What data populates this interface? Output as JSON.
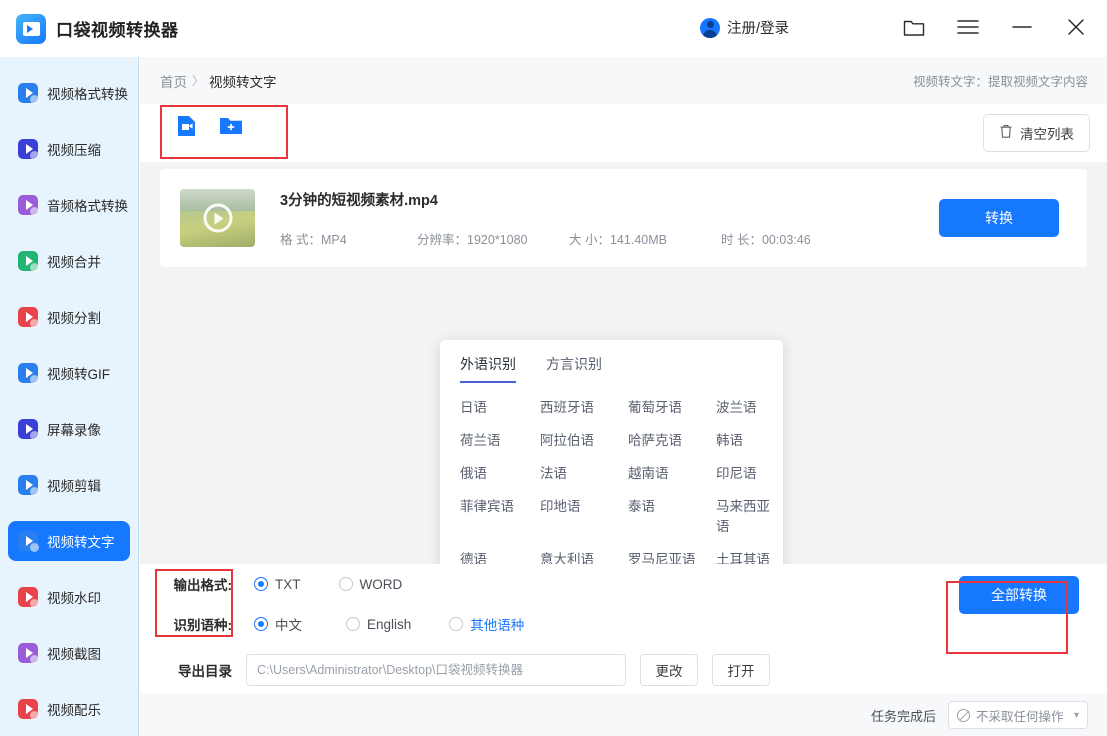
{
  "titlebar": {
    "app_title": "口袋视频转换器",
    "app_icon": "video-converter-logo",
    "account_label": "注册/登录",
    "account_icon": "avatar-icon",
    "window_buttons": [
      {
        "name": "folder-icon",
        "label": "folder"
      },
      {
        "name": "menu-icon",
        "label": "menu"
      },
      {
        "name": "minimize-icon",
        "label": "minimize"
      },
      {
        "name": "close-icon",
        "label": "close"
      }
    ]
  },
  "sidebar": {
    "items": [
      {
        "label": "视频格式转换",
        "icon": "video-format-convert-icon",
        "color": "#2b7ef0",
        "active": false
      },
      {
        "label": "视频压缩",
        "icon": "video-compress-icon",
        "color": "#3a3fd8",
        "active": false
      },
      {
        "label": "音频格式转换",
        "icon": "audio-format-convert-icon",
        "color": "#9a5cd8",
        "active": false
      },
      {
        "label": "视频合并",
        "icon": "video-merge-icon",
        "color": "#22b573",
        "active": false
      },
      {
        "label": "视频分割",
        "icon": "video-split-icon",
        "color": "#e8434a",
        "active": false
      },
      {
        "label": "视频转GIF",
        "icon": "video-to-gif-icon",
        "color": "#2b7ef0",
        "active": false
      },
      {
        "label": "屏幕录像",
        "icon": "screen-record-icon",
        "color": "#3a3fd8",
        "active": false
      },
      {
        "label": "视频剪辑",
        "icon": "video-edit-icon",
        "color": "#2b7ef0",
        "active": false
      },
      {
        "label": "视频转文字",
        "icon": "video-to-text-icon",
        "color": "#2b7ef0",
        "active": true
      },
      {
        "label": "视频水印",
        "icon": "video-watermark-icon",
        "color": "#e8434a",
        "active": false
      },
      {
        "label": "视频截图",
        "icon": "video-screenshot-icon",
        "color": "#9a5cd8",
        "active": false
      },
      {
        "label": "视频配乐",
        "icon": "video-music-icon",
        "color": "#e8434a",
        "active": false
      }
    ]
  },
  "breadcrumb": {
    "home": "首页",
    "separator": "〉",
    "current": "视频转文字",
    "hint": "视频转文字：提取视频文字内容"
  },
  "toolbar": {
    "add_file_icon": "add-video-file-icon",
    "add_folder_icon": "add-folder-icon",
    "clear_label": "清空列表",
    "clear_icon": "trash-icon"
  },
  "file": {
    "name": "3分钟的短视频素材.mp4",
    "thumbnail_icon": "video-thumbnail",
    "play_icon": "play-icon",
    "meta": [
      {
        "label": "格 式：",
        "value": "MP4"
      },
      {
        "label": "分辨率：",
        "value": "1920*1080"
      },
      {
        "label": "大 小：",
        "value": "141.40MB"
      },
      {
        "label": "时 长：",
        "value": "00:03:46"
      }
    ],
    "convert_label": "转换"
  },
  "language_popup": {
    "tabs": [
      {
        "label": "外语识别",
        "active": true
      },
      {
        "label": "方言识别",
        "active": false
      }
    ],
    "languages": [
      "日语",
      "西班牙语",
      "葡萄牙语",
      "波兰语",
      "荷兰语",
      "阿拉伯语",
      "哈萨克语",
      "韩语",
      "俄语",
      "法语",
      "越南语",
      "印尼语",
      "菲律宾语",
      "印地语",
      "泰语",
      "马来西亚语",
      "德语",
      "意大利语",
      "罗马尼亚语",
      "土耳其语"
    ]
  },
  "settings": {
    "output_format_label": "输出格式:",
    "output_formats": [
      {
        "label": "TXT",
        "selected": true
      },
      {
        "label": "WORD",
        "selected": false
      }
    ],
    "recognize_language_label": "识别语种:",
    "recognize_languages": [
      {
        "label": "中文",
        "selected": true,
        "highlight": false
      },
      {
        "label": "English",
        "selected": false,
        "highlight": false
      },
      {
        "label": "其他语种",
        "selected": false,
        "highlight": true
      }
    ],
    "export_dir_label": "导出目录",
    "export_dir_value": "C:\\Users\\Administrator\\Desktop\\口袋视频转换器",
    "change_label": "更改",
    "open_label": "打开",
    "convert_all_label": "全部转换"
  },
  "bottombar": {
    "after_task_label": "任务完成后",
    "after_task_value": "不采取任何操作",
    "no_action_icon": "ban-icon",
    "caret_icon": "chevron-down-icon"
  },
  "colors": {
    "accent": "#1677ff",
    "sidebar_bg": "#e8f4fd",
    "main_bg": "#f2f3f5",
    "annotation": "#e8363c"
  }
}
